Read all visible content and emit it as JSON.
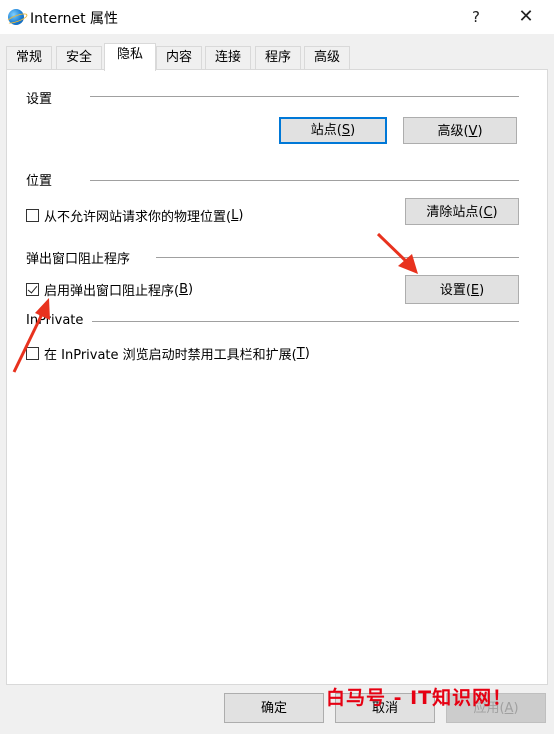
{
  "window": {
    "title": "Internet 属性",
    "help_glyph": "?",
    "close_glyph": "✕"
  },
  "tabs": [
    {
      "label": "常规"
    },
    {
      "label": "安全"
    },
    {
      "label": "隐私",
      "active": true
    },
    {
      "label": "内容"
    },
    {
      "label": "连接"
    },
    {
      "label": "程序"
    },
    {
      "label": "高级"
    }
  ],
  "settings_section": {
    "label": "设置",
    "sites_button": {
      "text": "站点(",
      "key": "S",
      "tail": ")"
    },
    "advanced_button": {
      "text": "高级(",
      "key": "V",
      "tail": ")"
    }
  },
  "location_section": {
    "label": "位置",
    "checkbox": {
      "checked": false,
      "text": "从不允许网站请求你的物理位置(",
      "key": "L",
      "tail": ")"
    },
    "clear_button": {
      "text": "清除站点(",
      "key": "C",
      "tail": ")"
    }
  },
  "popup_section": {
    "label": "弹出窗口阻止程序",
    "checkbox": {
      "checked": true,
      "text": "启用弹出窗口阻止程序(",
      "key": "B",
      "tail": ")"
    },
    "settings_button": {
      "text": "设置(",
      "key": "E",
      "tail": ")"
    }
  },
  "inprivate_section": {
    "label": "InPrivate",
    "checkbox": {
      "checked": false,
      "text": "在 InPrivate 浏览启动时禁用工具栏和扩展(",
      "key": "T",
      "tail": ")"
    }
  },
  "footer": {
    "ok": "确定",
    "cancel": "取消",
    "apply": {
      "text": "应用(",
      "key": "A",
      "tail": ")"
    }
  },
  "watermark": "白马号 - IT知识网！",
  "colors": {
    "arrow": "#e8321e",
    "accent": "#0078d7",
    "watermark": "#e60012"
  }
}
